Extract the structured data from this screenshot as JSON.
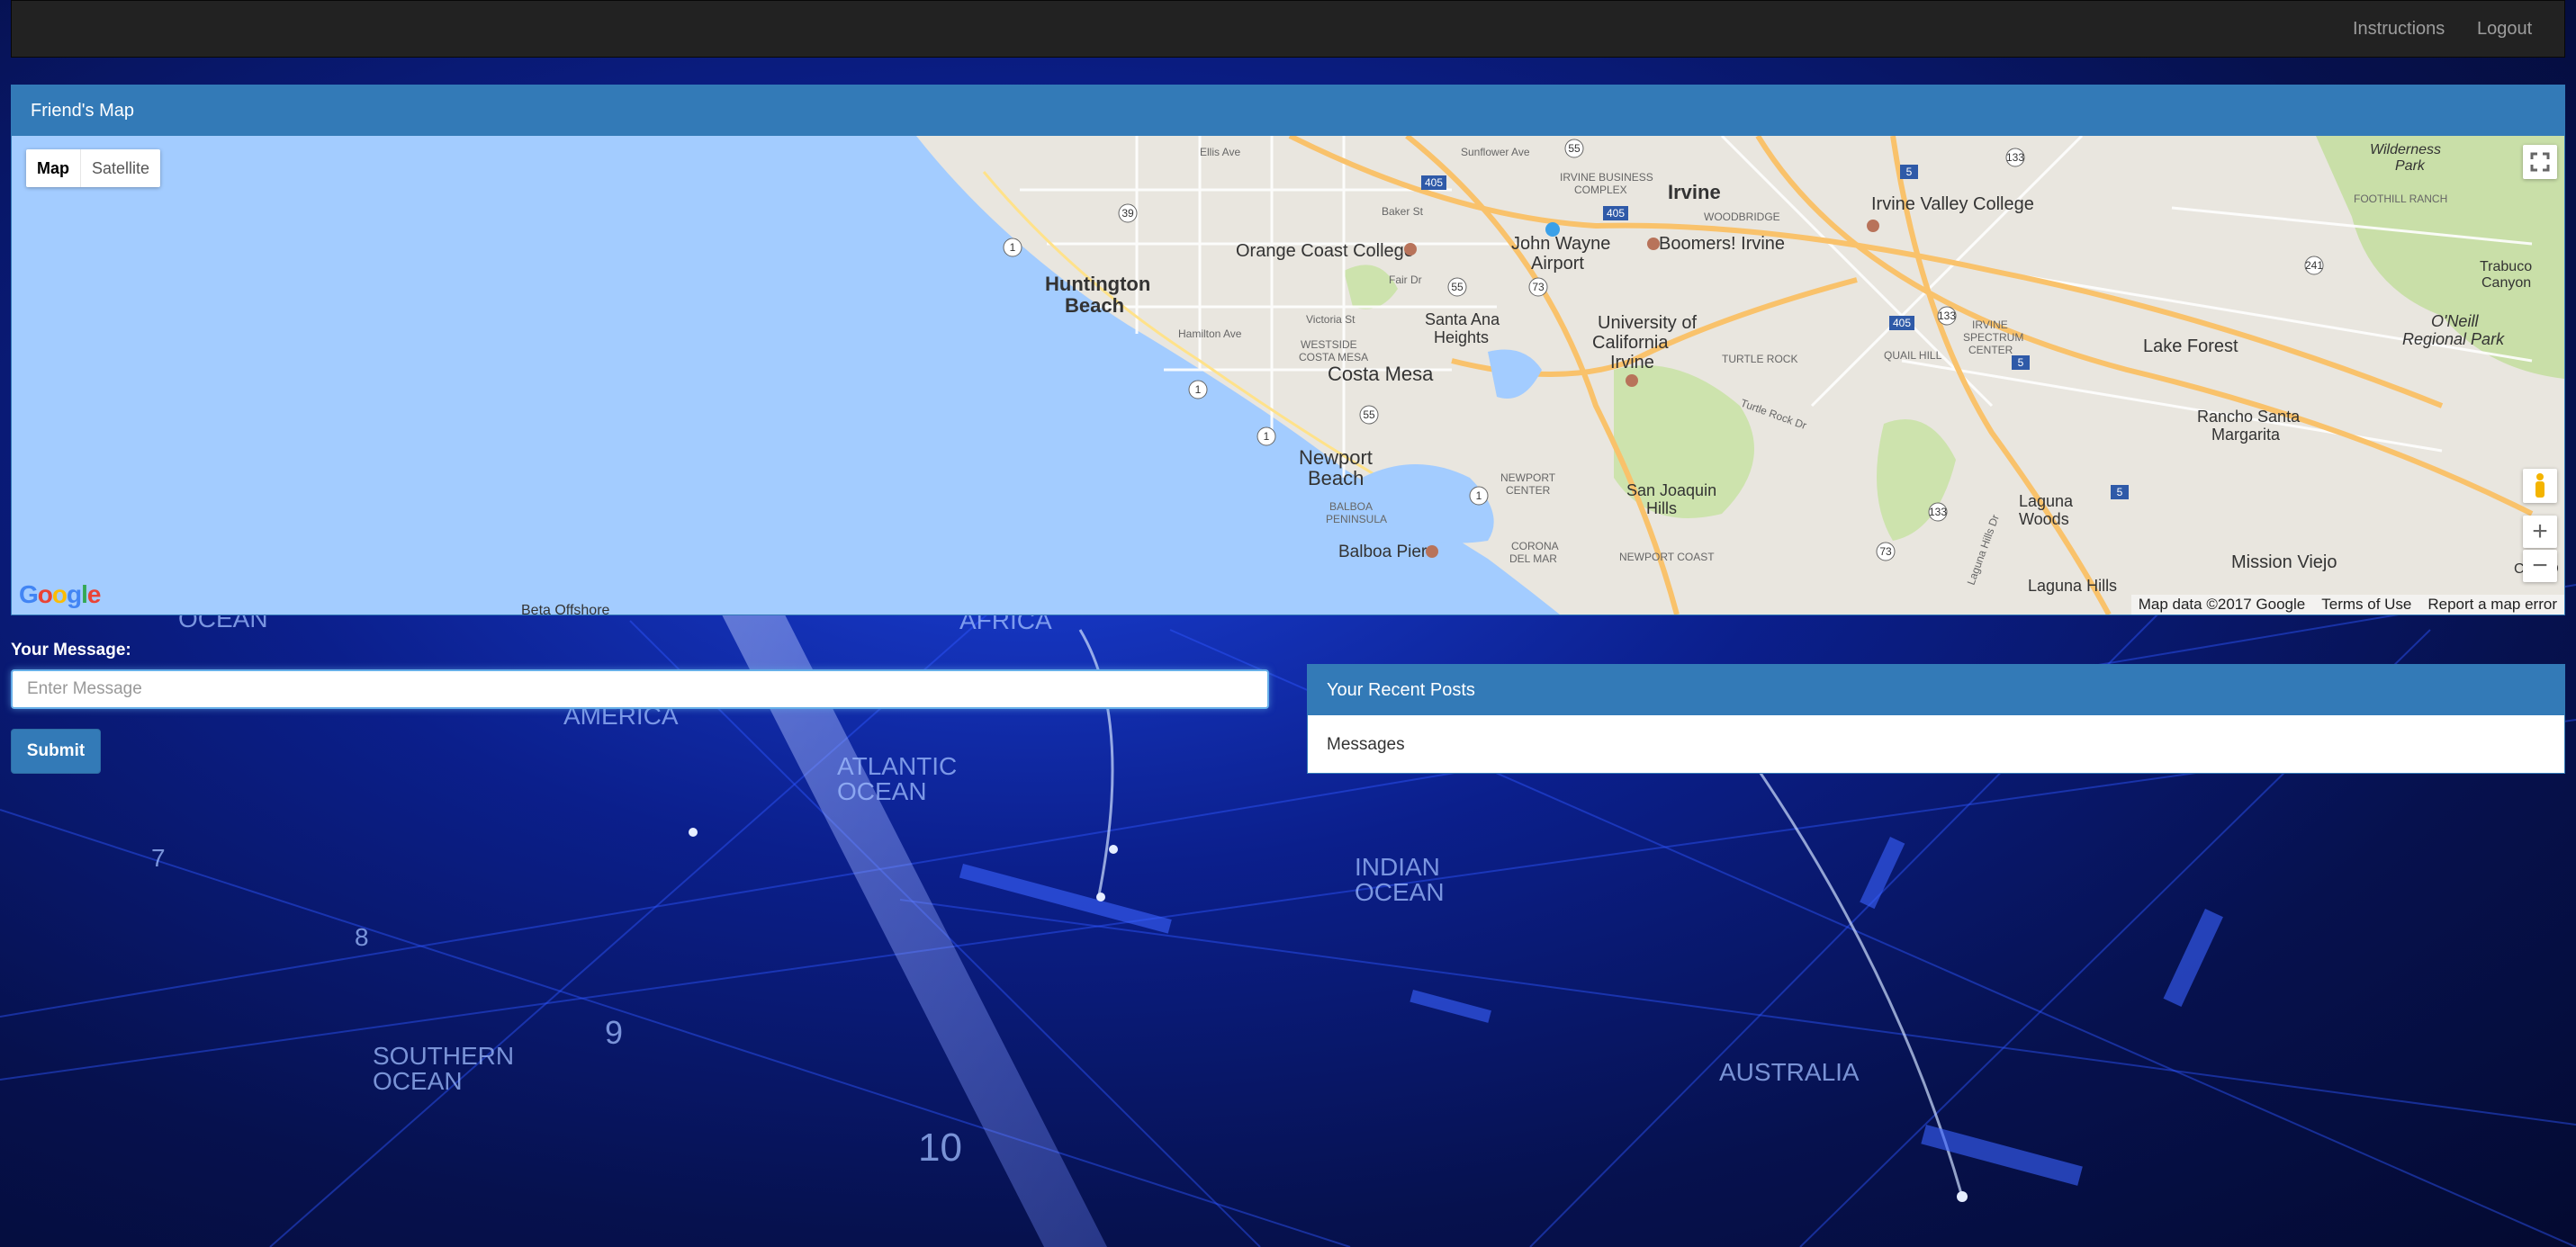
{
  "nav": {
    "instructions": "Instructions",
    "logout": "Logout"
  },
  "map_panel": {
    "title": "Friend's Map",
    "map_type": {
      "map": "Map",
      "satellite": "Satellite"
    },
    "attribution": {
      "data": "Map data ©2017 Google",
      "terms": "Terms of Use",
      "report": "Report a map error"
    },
    "logo": "Google",
    "places": [
      "Huntington Beach",
      "Irvine",
      "John Wayne Airport",
      "Orange Coast College",
      "Boomers! Irvine",
      "Irvine Valley College",
      "Costa Mesa",
      "Newport Beach",
      "Santa Ana Heights",
      "University of California Irvine",
      "Lake Forest",
      "Rancho Santa Margarita",
      "Mission Viejo",
      "Laguna Woods",
      "Laguna Hills",
      "Balboa Pier",
      "San Joaquin Hills",
      "O'Neill Regional Park",
      "Trabuco Canyon",
      "Turtle Rock",
      "Quail Hill",
      "Irvine Spectrum Center",
      "Woodbridge",
      "Irvine Business Complex",
      "Westside Costa Mesa",
      "Balboa Peninsula",
      "Newport Center",
      "Corona del Mar",
      "Newport Coast",
      "Foothill Ranch",
      "Wilderness Park",
      "Coto D",
      "Beta Offshore",
      "Ellis Ave",
      "Baker St",
      "Fair Dr",
      "Victoria St",
      "Hamilton Ave",
      "Sunflower Ave",
      "Turtle Rock Dr",
      "Laguna Hills Dr"
    ],
    "road_shields": [
      "405",
      "55",
      "73",
      "133",
      "241",
      "5",
      "1",
      "39"
    ]
  },
  "form": {
    "label": "Your Message:",
    "placeholder": "Enter Message",
    "submit": "Submit"
  },
  "posts_panel": {
    "title": "Your Recent Posts",
    "body": "Messages"
  },
  "background_labels": [
    "OCEAN",
    "AFRICA",
    "AMERICA",
    "ATLANTIC",
    "OCEAN",
    "INDIAN",
    "OCEAN",
    "SOUTHERN",
    "OCEAN",
    "AUSTRALIA",
    "7",
    "8",
    "9",
    "10"
  ]
}
